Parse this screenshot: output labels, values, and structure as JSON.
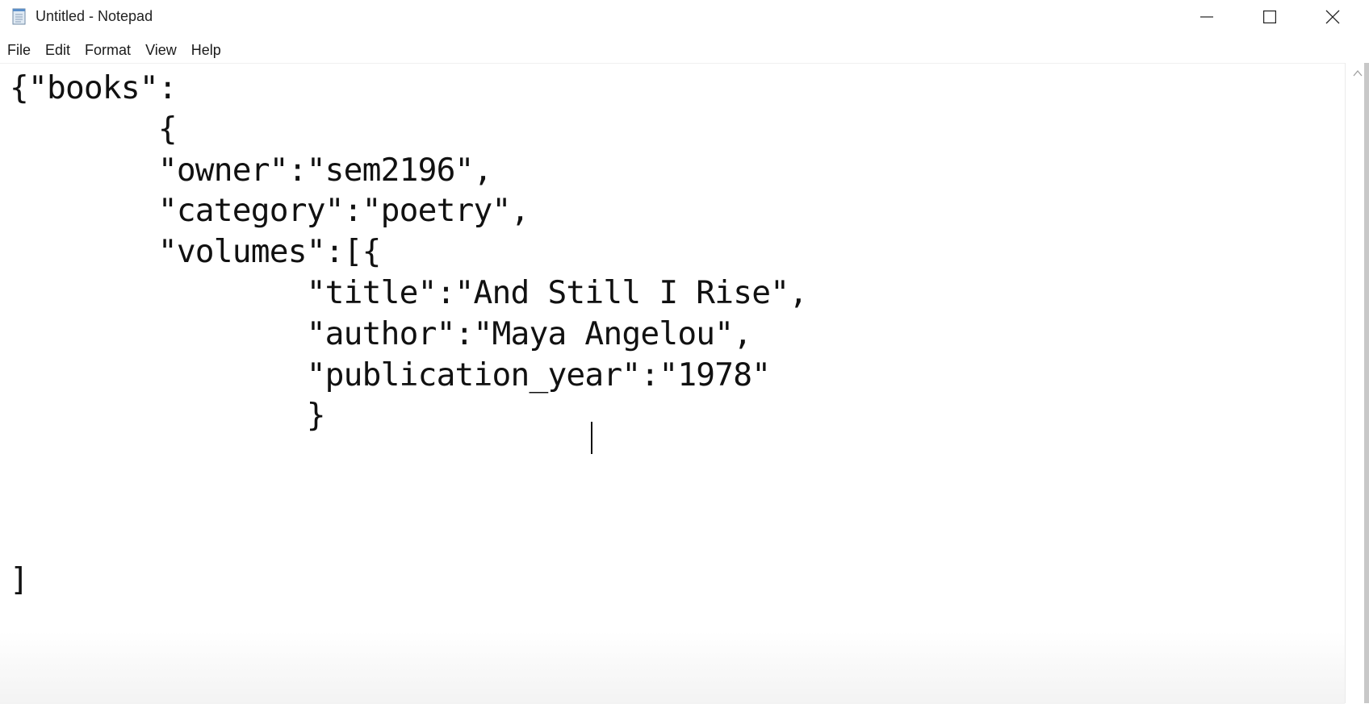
{
  "window": {
    "title": "Untitled - Notepad",
    "icons": {
      "app": "notepad-icon",
      "minimize": "minimize-icon",
      "maximize": "maximize-icon",
      "close": "close-icon"
    }
  },
  "menu": {
    "items": [
      {
        "label": "File"
      },
      {
        "label": "Edit"
      },
      {
        "label": "Format"
      },
      {
        "label": "View"
      },
      {
        "label": "Help"
      }
    ]
  },
  "editor": {
    "lines": [
      "{\"books\":",
      "        {",
      "        \"owner\":\"sem2196\",",
      "        \"category\":\"poetry\",",
      "        \"volumes\":[{",
      "                \"title\":\"And Still I Rise\",",
      "                \"author\":\"Maya Angelou\",",
      "                \"publication_year\":\"1978\"",
      "                }",
      "",
      "",
      "",
      "]"
    ]
  },
  "scrollbar": {
    "up_icon": "scroll-up-arrow-icon"
  }
}
